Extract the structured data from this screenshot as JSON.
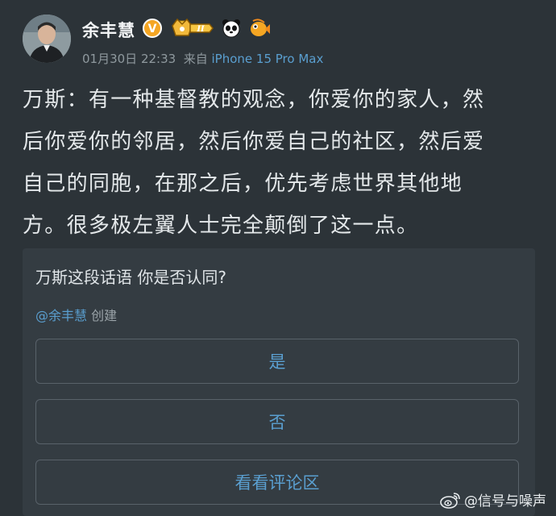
{
  "post": {
    "author": "余丰慧",
    "date": "01月30日 22:33",
    "source_prefix": "来自",
    "device": "iPhone 15 Pro Max",
    "badges": [
      "verified-v-icon",
      "crown-level-badge-icon",
      "panda-emoji-icon",
      "fish-emoji-icon"
    ],
    "badge_level_text": "II",
    "verified_mark": "V",
    "body_lines": [
      "万斯：有一种基督教的观念，你爱你的家人，然",
      "后你爱你的邻居，然后你爱自己的社区，然后爱",
      "自己的同胞，在那之后，优先考虑世界其他地",
      "方。很多极左翼人士完全颠倒了这一点。"
    ]
  },
  "poll": {
    "question": "万斯这段话语 你是否认同?",
    "creator_mention": "@余丰慧",
    "creator_suffix": " 创建",
    "options": [
      "是",
      "否",
      "看看评论区"
    ]
  },
  "watermark": {
    "text": "@信号与噪声",
    "icon": "weibo-logo-icon"
  },
  "colors": {
    "background": "#2c3338",
    "card": "#343c42",
    "link": "#5a9fd0",
    "meta": "#8f999e",
    "verified": "#f5a623"
  }
}
